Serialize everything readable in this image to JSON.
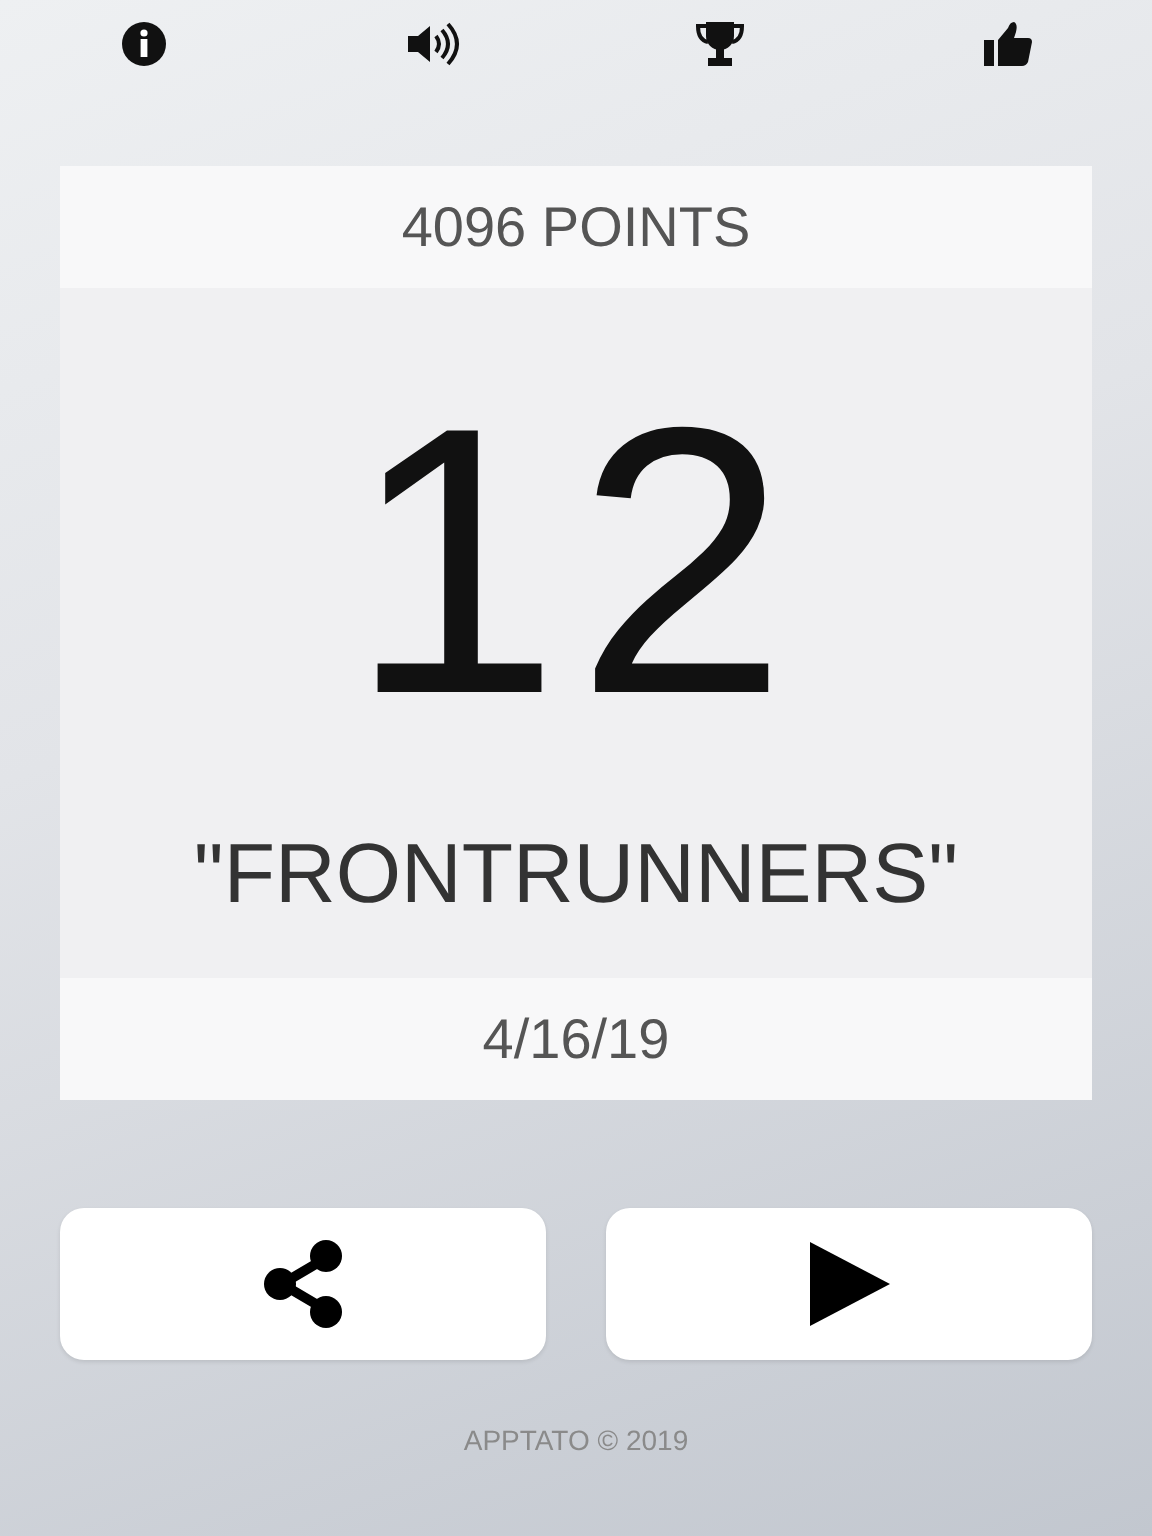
{
  "score_card": {
    "points": "4096 POINTS",
    "rank": "12",
    "rank_title": "\"FRONTRUNNERS\"",
    "date": "4/16/19"
  },
  "footer": "APPTATO © 2019"
}
